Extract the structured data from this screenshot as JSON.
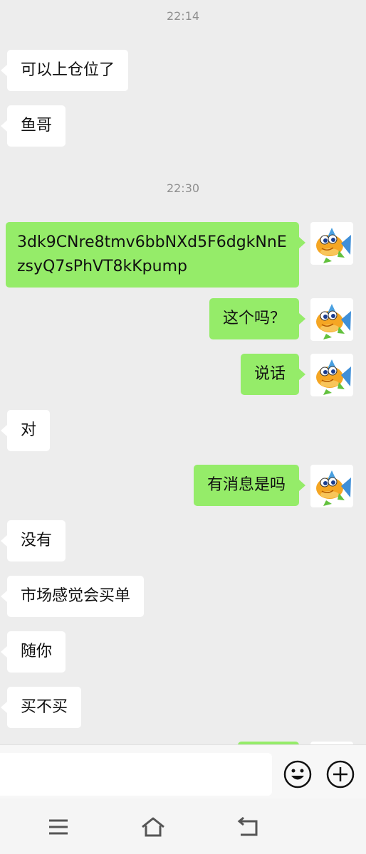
{
  "messages": [
    {
      "type": "time",
      "text": "22:14"
    },
    {
      "type": "in",
      "text": "可以上仓位了"
    },
    {
      "type": "in",
      "text": "鱼哥"
    },
    {
      "type": "time",
      "text": "22:30"
    },
    {
      "type": "out",
      "text": "3dk9CNre8tmv6bbNXd5F6dgkNnEzsyQ7sPhVT8kKpump"
    },
    {
      "type": "out",
      "text": "这个吗？"
    },
    {
      "type": "out",
      "text": "说话"
    },
    {
      "type": "in",
      "text": "对"
    },
    {
      "type": "out",
      "text": "有消息是吗"
    },
    {
      "type": "in",
      "text": "没有"
    },
    {
      "type": "in",
      "text": "市场感觉会买单"
    },
    {
      "type": "in",
      "text": "随你"
    },
    {
      "type": "in",
      "text": "买不买"
    }
  ],
  "input": {
    "placeholder": "",
    "value": ""
  },
  "icons": {
    "avatar": "fish-avatar-icon",
    "emoji": "smiley-icon",
    "more": "plus-circle-icon",
    "nav_menu": "menu-icon",
    "nav_home": "home-icon",
    "nav_back": "back-icon"
  },
  "colors": {
    "outgoing_bubble": "#95ec69",
    "incoming_bubble": "#ffffff",
    "background": "#ededed"
  }
}
